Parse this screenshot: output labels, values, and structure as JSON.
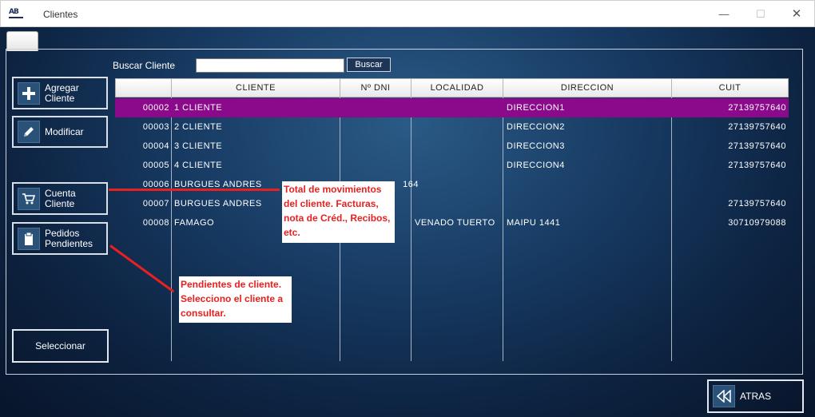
{
  "window": {
    "app_icon_text": "AB",
    "title": "Clientes",
    "minimize": "—",
    "maximize": "☐",
    "close": "✕"
  },
  "search": {
    "label": "Buscar Cliente",
    "value": "",
    "placeholder": "",
    "button_label": "Buscar"
  },
  "sidebar": {
    "agregar": {
      "label": "Agregar\nCliente",
      "icon": "plus-icon"
    },
    "modificar": {
      "label": "Modificar",
      "icon": "pencil-icon"
    },
    "cuenta": {
      "label": "Cuenta\nCliente",
      "icon": "cart-icon"
    },
    "pedidos": {
      "label": "Pedidos\nPendientes",
      "icon": "clipboard-icon"
    },
    "seleccionar": {
      "label": "Seleccionar"
    }
  },
  "grid": {
    "columns": [
      "",
      "CLIENTE",
      "Nº DNI",
      "LOCALIDAD",
      "DIRECCION",
      "CUIT"
    ],
    "rows": [
      {
        "id": "00002",
        "cliente": "1 CLIENTE",
        "dni": "",
        "localidad": "",
        "direccion": "DIRECCION1",
        "cuit": "27139757640",
        "selected": true
      },
      {
        "id": "00003",
        "cliente": "2 CLIENTE",
        "dni": "",
        "localidad": "",
        "direccion": "DIRECCION2",
        "cuit": "27139757640",
        "selected": false
      },
      {
        "id": "00004",
        "cliente": "3 CLIENTE",
        "dni": "",
        "localidad": "",
        "direccion": "DIRECCION3",
        "cuit": "27139757640",
        "selected": false
      },
      {
        "id": "00005",
        "cliente": "4 CLIENTE",
        "dni": "",
        "localidad": "",
        "direccion": "DIRECCION4",
        "cuit": "27139757640",
        "selected": false
      },
      {
        "id": "00006",
        "cliente": "BURGUES ANDRES",
        "dni": "164",
        "localidad": "",
        "direccion": "",
        "cuit": "",
        "selected": false
      },
      {
        "id": "00007",
        "cliente": "BURGUES ANDRES",
        "dni": "",
        "localidad": "",
        "direccion": "",
        "cuit": "27139757640",
        "selected": false
      },
      {
        "id": "00008",
        "cliente": "FAMAGO",
        "dni": "",
        "localidad": "VENADO TUERTO",
        "direccion": "MAIPU 1441",
        "cuit": "30710979088",
        "selected": false
      }
    ]
  },
  "annotations": {
    "callout1": "Total de movimientos del cliente. Facturas, nota de Créd., Recibos, etc.",
    "callout2": "Pendientes de cliente. Selecciono el cliente a consultar.",
    "color": "#e8201f"
  },
  "footer": {
    "atras_label": "ATRAS",
    "atras_icon": "double-rewind-icon"
  },
  "colors": {
    "selected_row": "#8b0a8b",
    "background": "#173a62"
  }
}
